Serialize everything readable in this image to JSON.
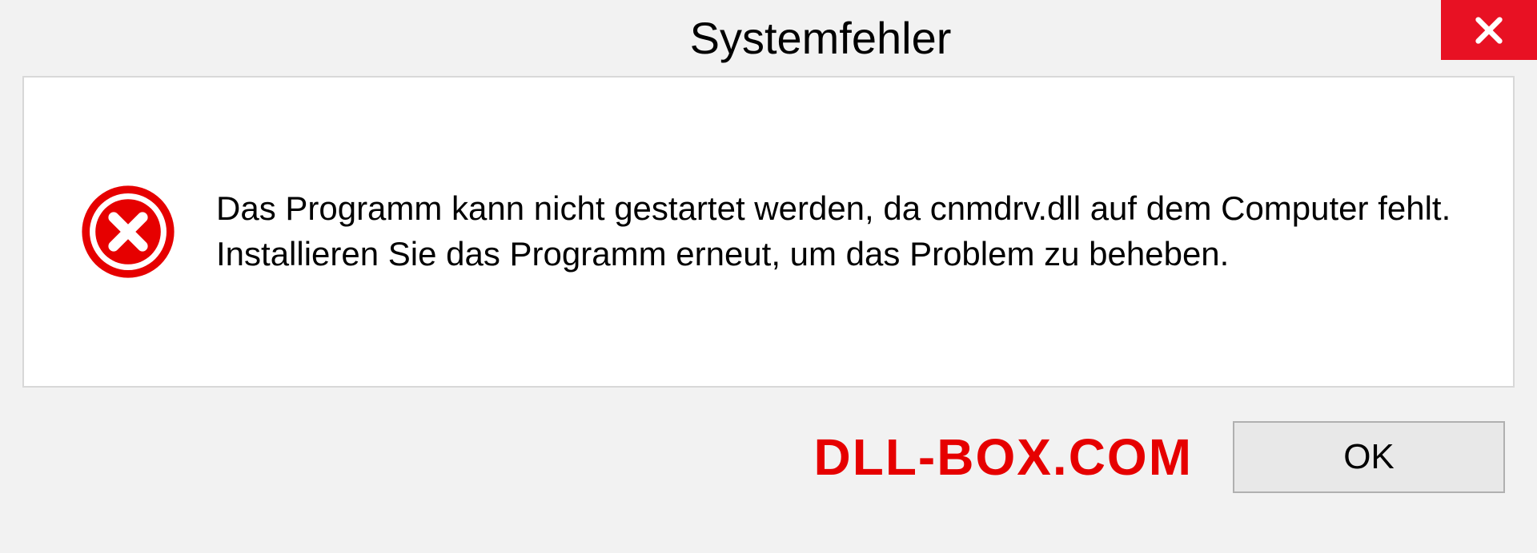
{
  "dialog": {
    "title": "Systemfehler",
    "message": "Das Programm kann nicht gestartet werden, da cnmdrv.dll auf dem Computer fehlt. Installieren Sie das Programm erneut, um das Problem zu beheben.",
    "ok_label": "OK"
  },
  "watermark": "DLL-BOX.COM"
}
